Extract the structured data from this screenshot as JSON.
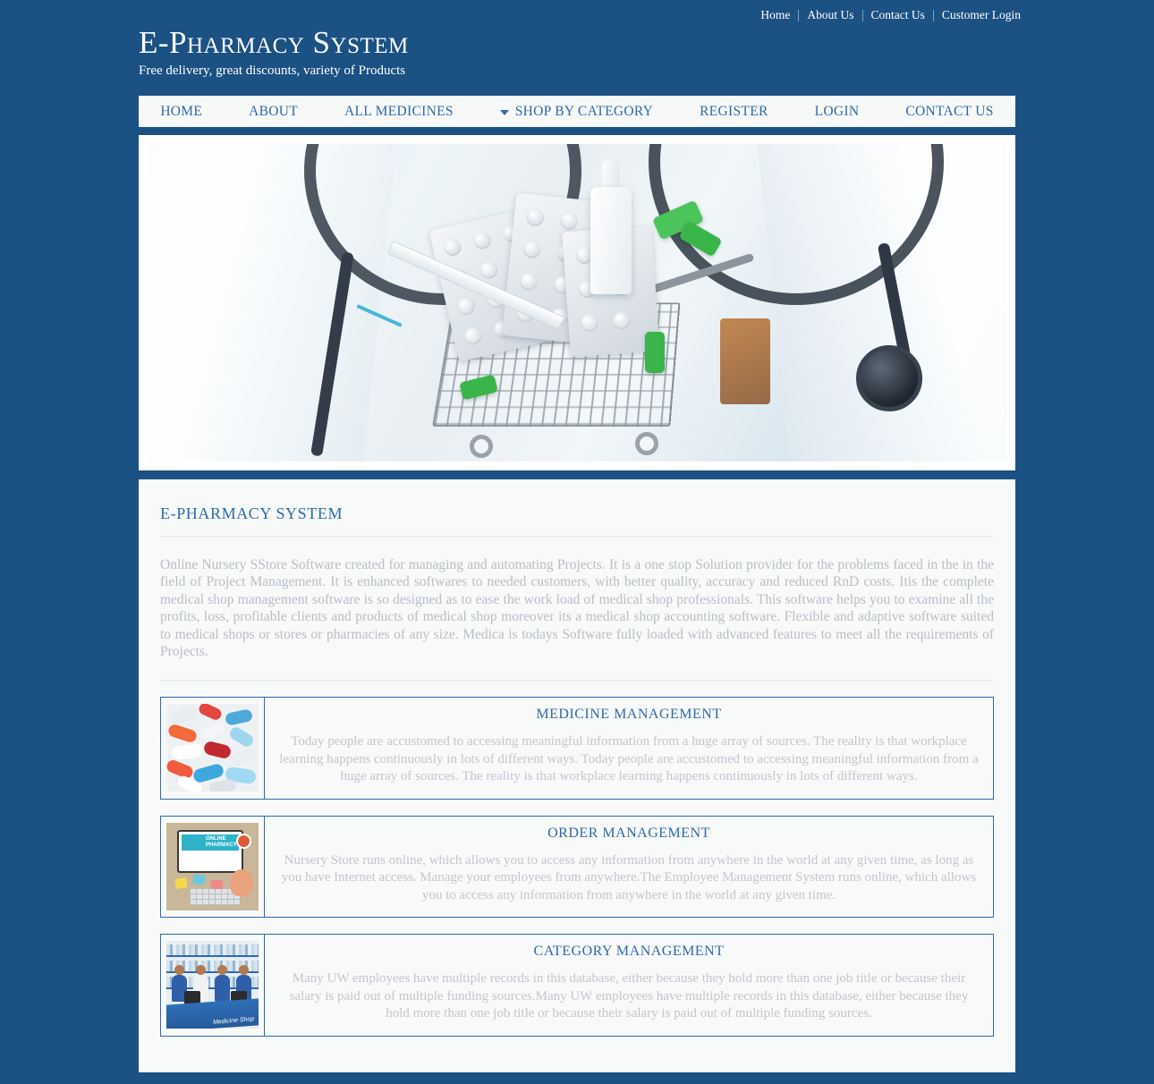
{
  "topbar": {
    "links": [
      {
        "label": "Home"
      },
      {
        "label": "About Us"
      },
      {
        "label": "Contact Us"
      },
      {
        "label": "Customer Login"
      }
    ]
  },
  "brand": {
    "title": "E-Pharmacy System",
    "tagline": "Free delivery, great discounts, variety of Products"
  },
  "nav": {
    "items": [
      {
        "label": "HOME",
        "caret": false
      },
      {
        "label": "ABOUT",
        "caret": false
      },
      {
        "label": "ALL MEDICINES",
        "caret": false
      },
      {
        "label": "SHOP BY CATEGORY",
        "caret": true
      },
      {
        "label": "REGISTER",
        "caret": false
      },
      {
        "label": "LOGIN",
        "caret": false
      },
      {
        "label": "CONTACT US",
        "caret": false
      }
    ]
  },
  "hero": {
    "alt": "Pharmacist in white coat with stethoscope holding a miniature shopping cart full of medicines, pill blisters and a nasal spray"
  },
  "main": {
    "section_title": "E-PHARMACY SYSTEM",
    "intro": "Online Nursery SStore Software created for managing and automating Projects. It is a one stop Solution provider for the problems faced in the in the field of Project Management. It is enhanced softwares to needed customers, with better quality, accuracy and reduced RnD costs. Itis the complete medical shop management software is so designed as to ease the work load of medical shop professionals. This software helps you to examine all the profits, loss, profitable clients and products of medical shop moreover its a medical shop accounting software. Flexible and adaptive software suited to medical shops or stores or pharmacies of any size. Medica is todays Software fully loaded with advanced features to meet all the requirements of Projects.",
    "features": [
      {
        "title": "MEDICINE MANAGEMENT",
        "text": "Today people are accustomed to accessing meaningful information from a huge array of sources. The reality is that workplace learning happens continuously in lots of different ways. Today people are accustomed to accessing meaningful information from a huge array of sources. The reality is that workplace learning happens continuously in lots of different ways.",
        "thumb": "pills-thumbnail"
      },
      {
        "title": "ORDER MANAGEMENT",
        "text": "Nursery Store runs online, which allows you to access any information from anywhere in the world at any given time, as long as you have Internet access. Manage your employees from anywhere.The Employee Management System runs online, which allows you to access any information from anywhere in the world at any given time.",
        "thumb": "online-pharmacy-desk-thumbnail"
      },
      {
        "title": "CATEGORY MANAGEMENT",
        "text": "Many UW employees have multiple records in this database, either because they hold more than one job title or because their salary is paid out of multiple funding sources.Many UW employees have multiple records in this database, either because they hold more than one job title or because their salary is paid out of multiple funding sources.",
        "thumb": "medicine-shop-thumbnail"
      }
    ]
  },
  "thumb_art": {
    "desk_screen_line1": "ONLINE",
    "desk_screen_line2": "PHARMACY",
    "shop_counter_label": "Medicine Shop"
  },
  "colors": {
    "page_background": "#1b5183",
    "accent_blue": "#2f6aa8",
    "content_background": "#f8f9f9",
    "body_text": "#bcc2c8"
  }
}
